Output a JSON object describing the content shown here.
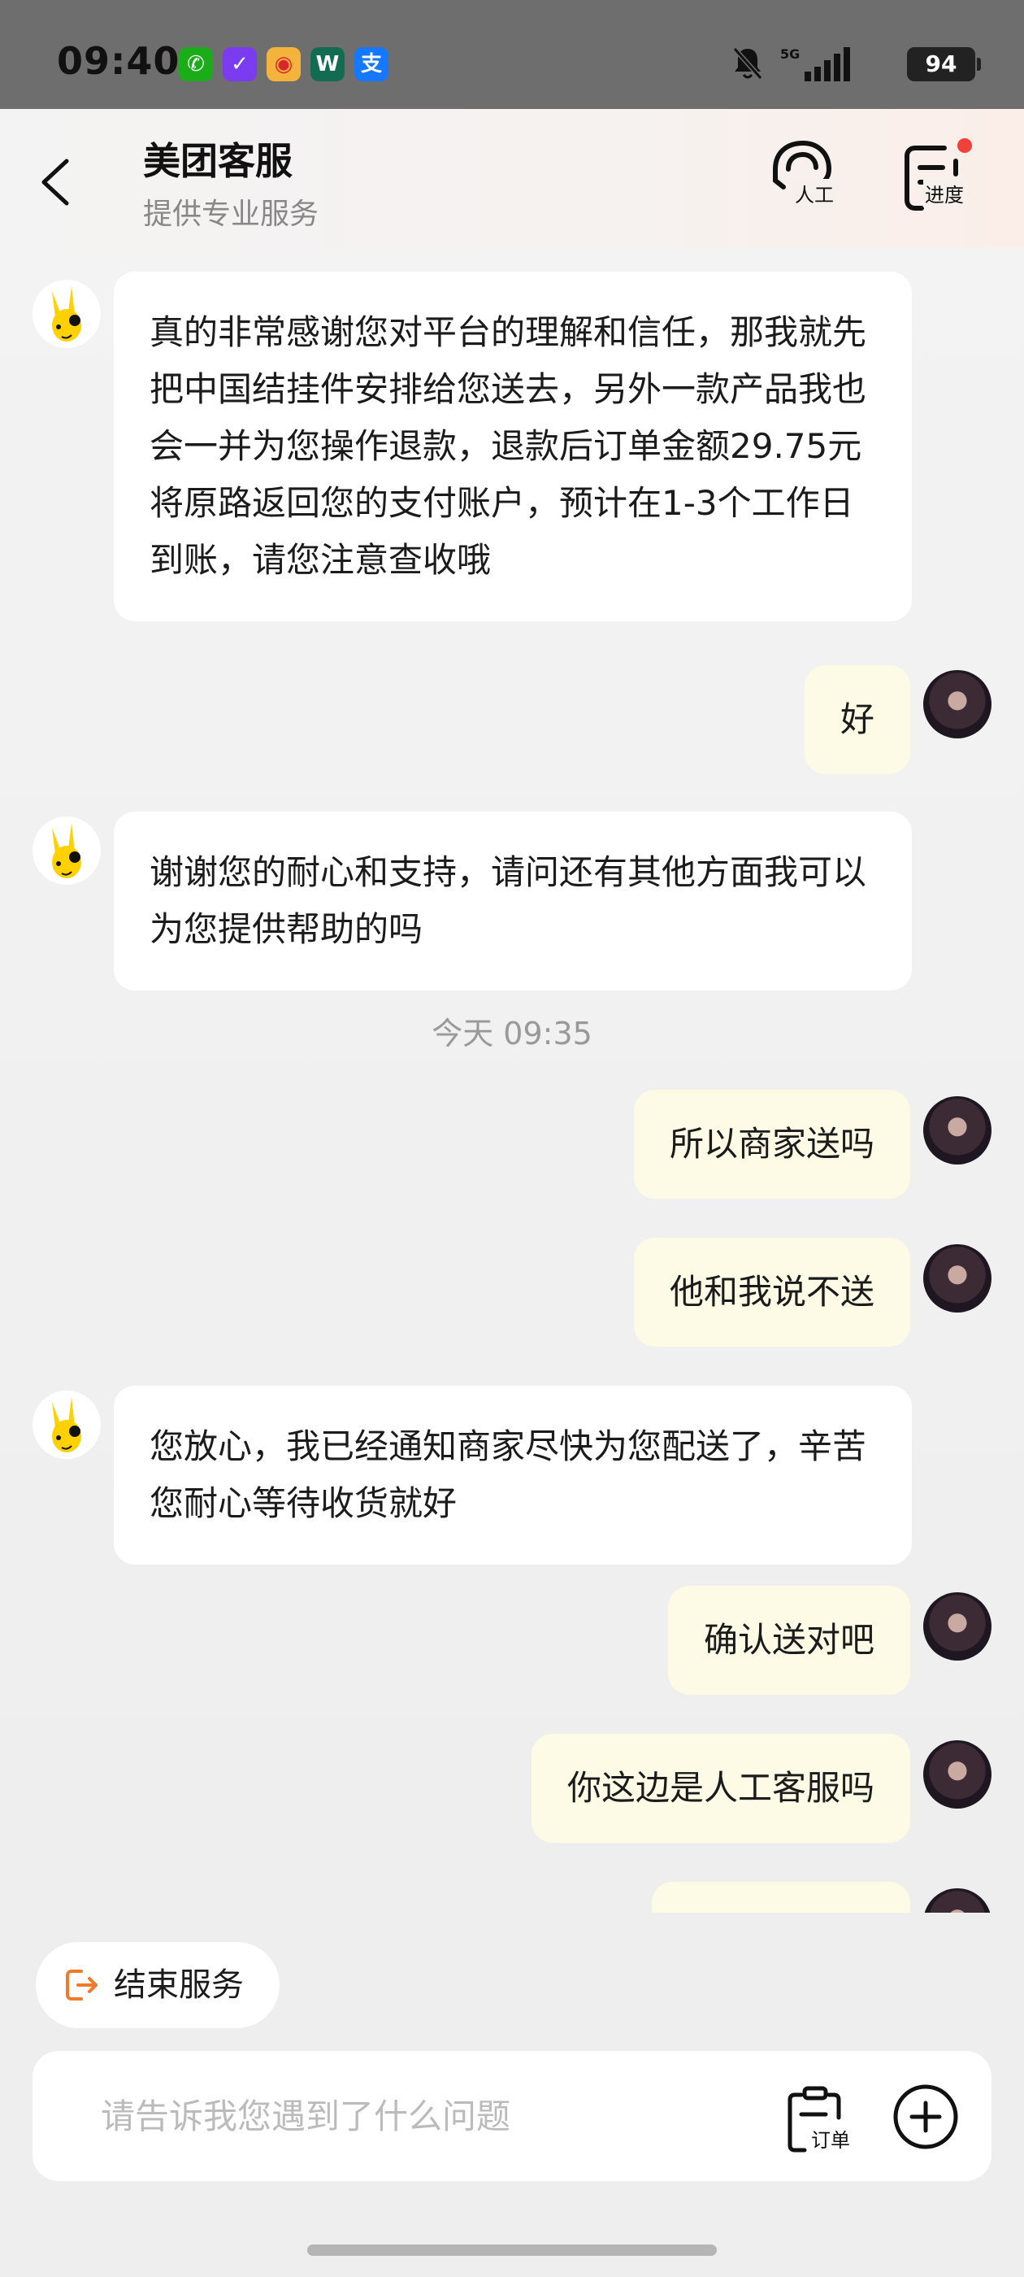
{
  "status_bar": {
    "time": "09:40",
    "apps": [
      {
        "icon": "wechat-icon",
        "glyph": "✆",
        "color": "#1aad19"
      },
      {
        "icon": "app-v-icon",
        "glyph": "✓",
        "color": "#7b3cf0"
      },
      {
        "icon": "weibo-icon",
        "glyph": "◉",
        "color": "#e94b3c"
      },
      {
        "icon": "app-w-icon",
        "glyph": "W",
        "color": "#136c4f"
      },
      {
        "icon": "alipay-icon",
        "glyph": "支",
        "color": "#1677ff"
      }
    ],
    "network": "5G",
    "battery": "94"
  },
  "header": {
    "title": "美团客服",
    "subtitle": "提供专业服务",
    "human_label": "人工",
    "progress_label": "进度"
  },
  "messages": [
    {
      "from": "bot",
      "text": "真的非常感谢您对平台的理解和信任，那我就先把中国结挂件安排给您送去，另外一款产品我也会一并为您操作退款，退款后订单金额29.75元将原路返回您的支付账户，预计在1-3个工作日到账，请您注意查收哦"
    },
    {
      "from": "user",
      "text": "好"
    },
    {
      "from": "bot",
      "text": "谢谢您的耐心和支持，请问还有其他方面我可以为您提供帮助的吗"
    },
    {
      "from": "time",
      "text": "今天 09:35"
    },
    {
      "from": "user",
      "text": "所以商家送吗"
    },
    {
      "from": "user",
      "text": "他和我说不送"
    },
    {
      "from": "bot",
      "text": "您放心，我已经通知商家尽快为您配送了，辛苦您耐心等待收货就好"
    },
    {
      "from": "user",
      "text": "确认送对吧"
    },
    {
      "from": "user",
      "text": "你这边是人工客服吗"
    }
  ],
  "bottom": {
    "end_service_label": "结束服务",
    "input_placeholder": "请告诉我您遇到了什么问题",
    "order_label": "订单"
  },
  "colors": {
    "user_bubble": "#fdfbe6",
    "bot_bubble": "#ffffff",
    "accent_orange": "#f07a2a",
    "badge_red": "#f0413a"
  }
}
